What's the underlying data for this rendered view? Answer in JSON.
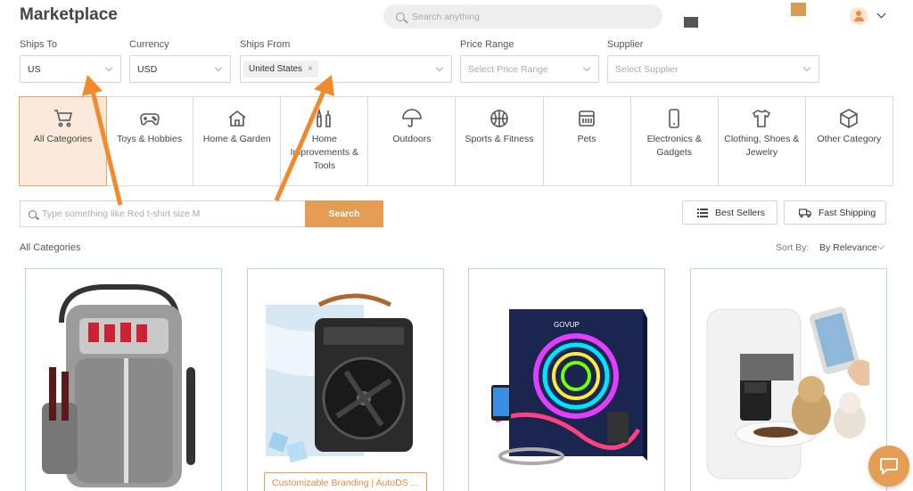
{
  "header": {
    "title": "Marketplace",
    "search_placeholder": "Search anything"
  },
  "filters": {
    "ships_to": {
      "label": "Ships To",
      "value": "US"
    },
    "currency": {
      "label": "Currency",
      "value": "USD"
    },
    "ships_from": {
      "label": "Ships From",
      "tag": "United States",
      "tag_remove": "×"
    },
    "price_range": {
      "label": "Price Range",
      "placeholder": "Select Price Range"
    },
    "supplier": {
      "label": "Supplier",
      "placeholder": "Select Supplier"
    }
  },
  "categories": [
    {
      "label": "All Categories",
      "icon": "cart-icon"
    },
    {
      "label": "Toys & Hobbies",
      "icon": "gamepad-icon"
    },
    {
      "label": "Home & Garden",
      "icon": "house-icon"
    },
    {
      "label": "Home Improvements & Tools",
      "icon": "tools-icon"
    },
    {
      "label": "Outdoors",
      "icon": "umbrella-icon"
    },
    {
      "label": "Sports & Fitness",
      "icon": "ball-icon"
    },
    {
      "label": "Pets",
      "icon": "pet-crate-icon"
    },
    {
      "label": "Electronics & Gadgets",
      "icon": "phone-icon"
    },
    {
      "label": "Clothing, Shoes & Jewelry",
      "icon": "shirt-icon"
    },
    {
      "label": "Other Category",
      "icon": "box-icon"
    }
  ],
  "product_search": {
    "placeholder": "Type something like Red t-shirt size M",
    "button": "Search"
  },
  "quick_filters": {
    "best_sellers": "Best Sellers",
    "fast_shipping": "Fast Shipping"
  },
  "listing": {
    "section_title": "All Categories",
    "sort_label": "Sort By:",
    "sort_value": "By Relevance"
  },
  "products": [
    {
      "image": "cooler-backpack"
    },
    {
      "image": "mini-air-cooler-fan",
      "badge": "Customizable Branding | AutoDS ..."
    },
    {
      "image": "led-strip-lights"
    },
    {
      "image": "automatic-pet-feeder"
    }
  ],
  "colors": {
    "accent": "#e59d54",
    "active_bg": "#fbeadc",
    "card_border": "#b9d4ea",
    "annotation_arrow": "#f08a2c"
  }
}
